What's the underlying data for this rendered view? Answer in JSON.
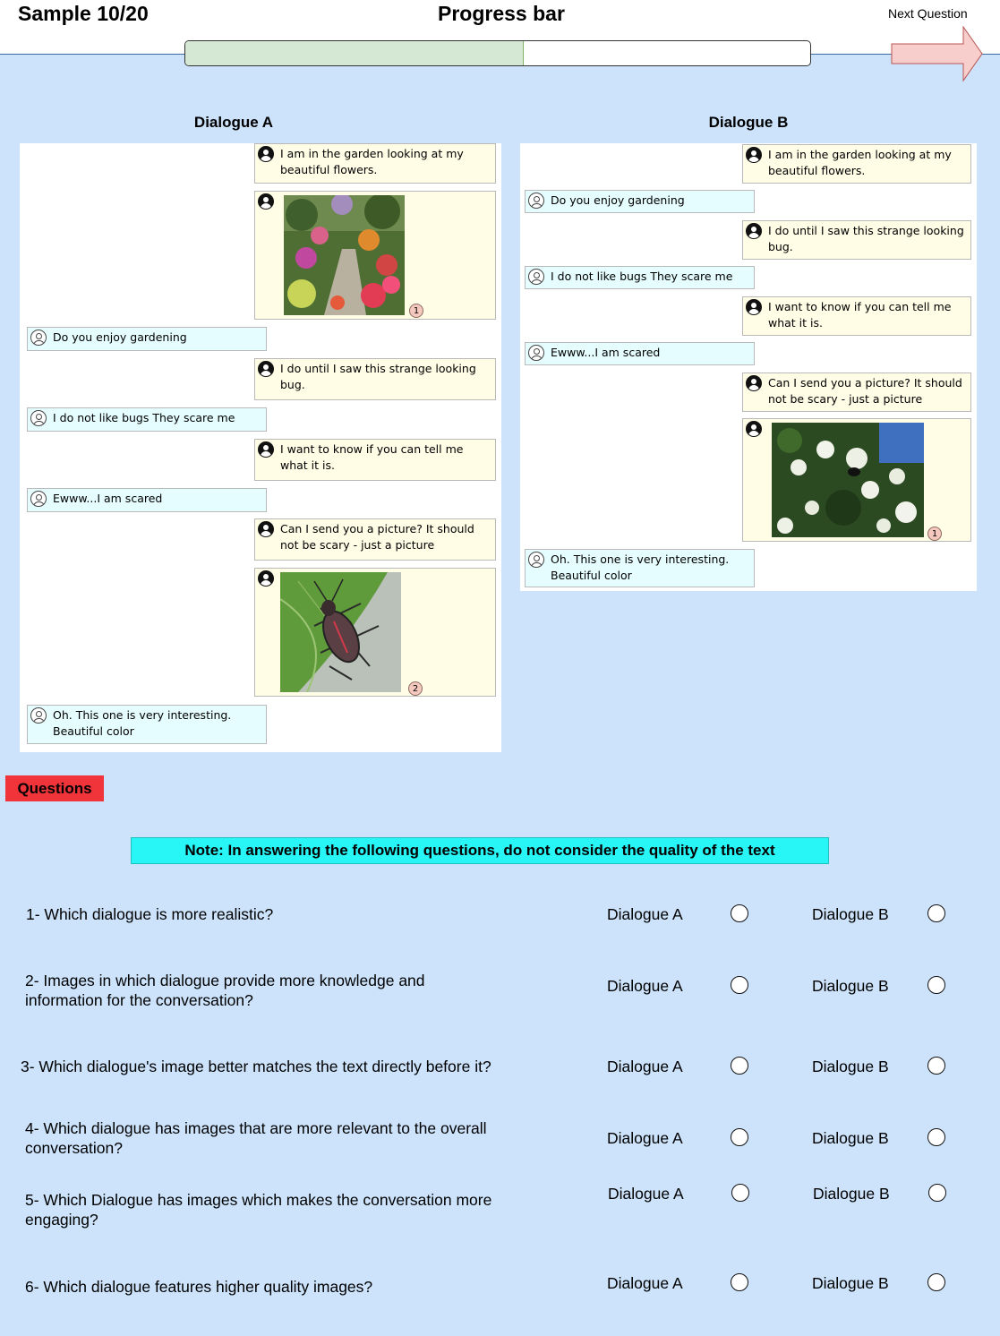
{
  "header": {
    "sample": "Sample 10/20",
    "progress_title": "Progress bar",
    "progress_fraction": 0.54,
    "next_label": "Next Question"
  },
  "dialogue_a": {
    "title": "Dialogue A",
    "messages": [
      "I am in the garden looking at my beautiful flowers.",
      "Do you enjoy gardening",
      "I do until I saw this strange looking bug.",
      "I do not like bugs They scare me",
      "I want to know if you can tell me what it is.",
      "Ewww...I am scared",
      "Can I send you a picture? It should not be scary - just a picture",
      "Oh. This one is very interesting. Beautiful color"
    ],
    "image_badges": [
      "1",
      "2"
    ]
  },
  "dialogue_b": {
    "title": "Dialogue B",
    "messages": [
      "I am in the garden looking at my beautiful flowers.",
      "Do you enjoy gardening",
      "I do until I saw this strange looking bug.",
      "I do not like bugs They scare me",
      "I want to know if you can tell me what it is.",
      "Ewww...I am scared",
      "Can I send you a picture? It should not be scary - just a picture",
      "Oh. This one is very interesting. Beautiful color"
    ],
    "image_badges": [
      "1"
    ]
  },
  "questions_section": {
    "label": "Questions",
    "note": "Note: In answering the following questions, do not consider the quality of the text",
    "option_a": "Dialogue A",
    "option_b": "Dialogue B",
    "items": [
      "1- Which dialogue is more realistic?",
      "2- Images in which dialogue provide more knowledge and information for the conversation?",
      "3- Which dialogue's image better matches the text directly before it?",
      "4- Which dialogue has images that are more relevant to the overall conversation?",
      "5- Which Dialogue has images which makes the conversation more engaging?",
      "6- Which dialogue features higher quality images?"
    ]
  },
  "colors": {
    "background": "#cce3fb",
    "progress_fill": "#d5e8d4",
    "arrow": "#f8cecc",
    "questions_label": "#f0343a",
    "note": "#27f5f6",
    "user_bubble": "#fffde6",
    "bot_bubble": "#e6fdff"
  }
}
